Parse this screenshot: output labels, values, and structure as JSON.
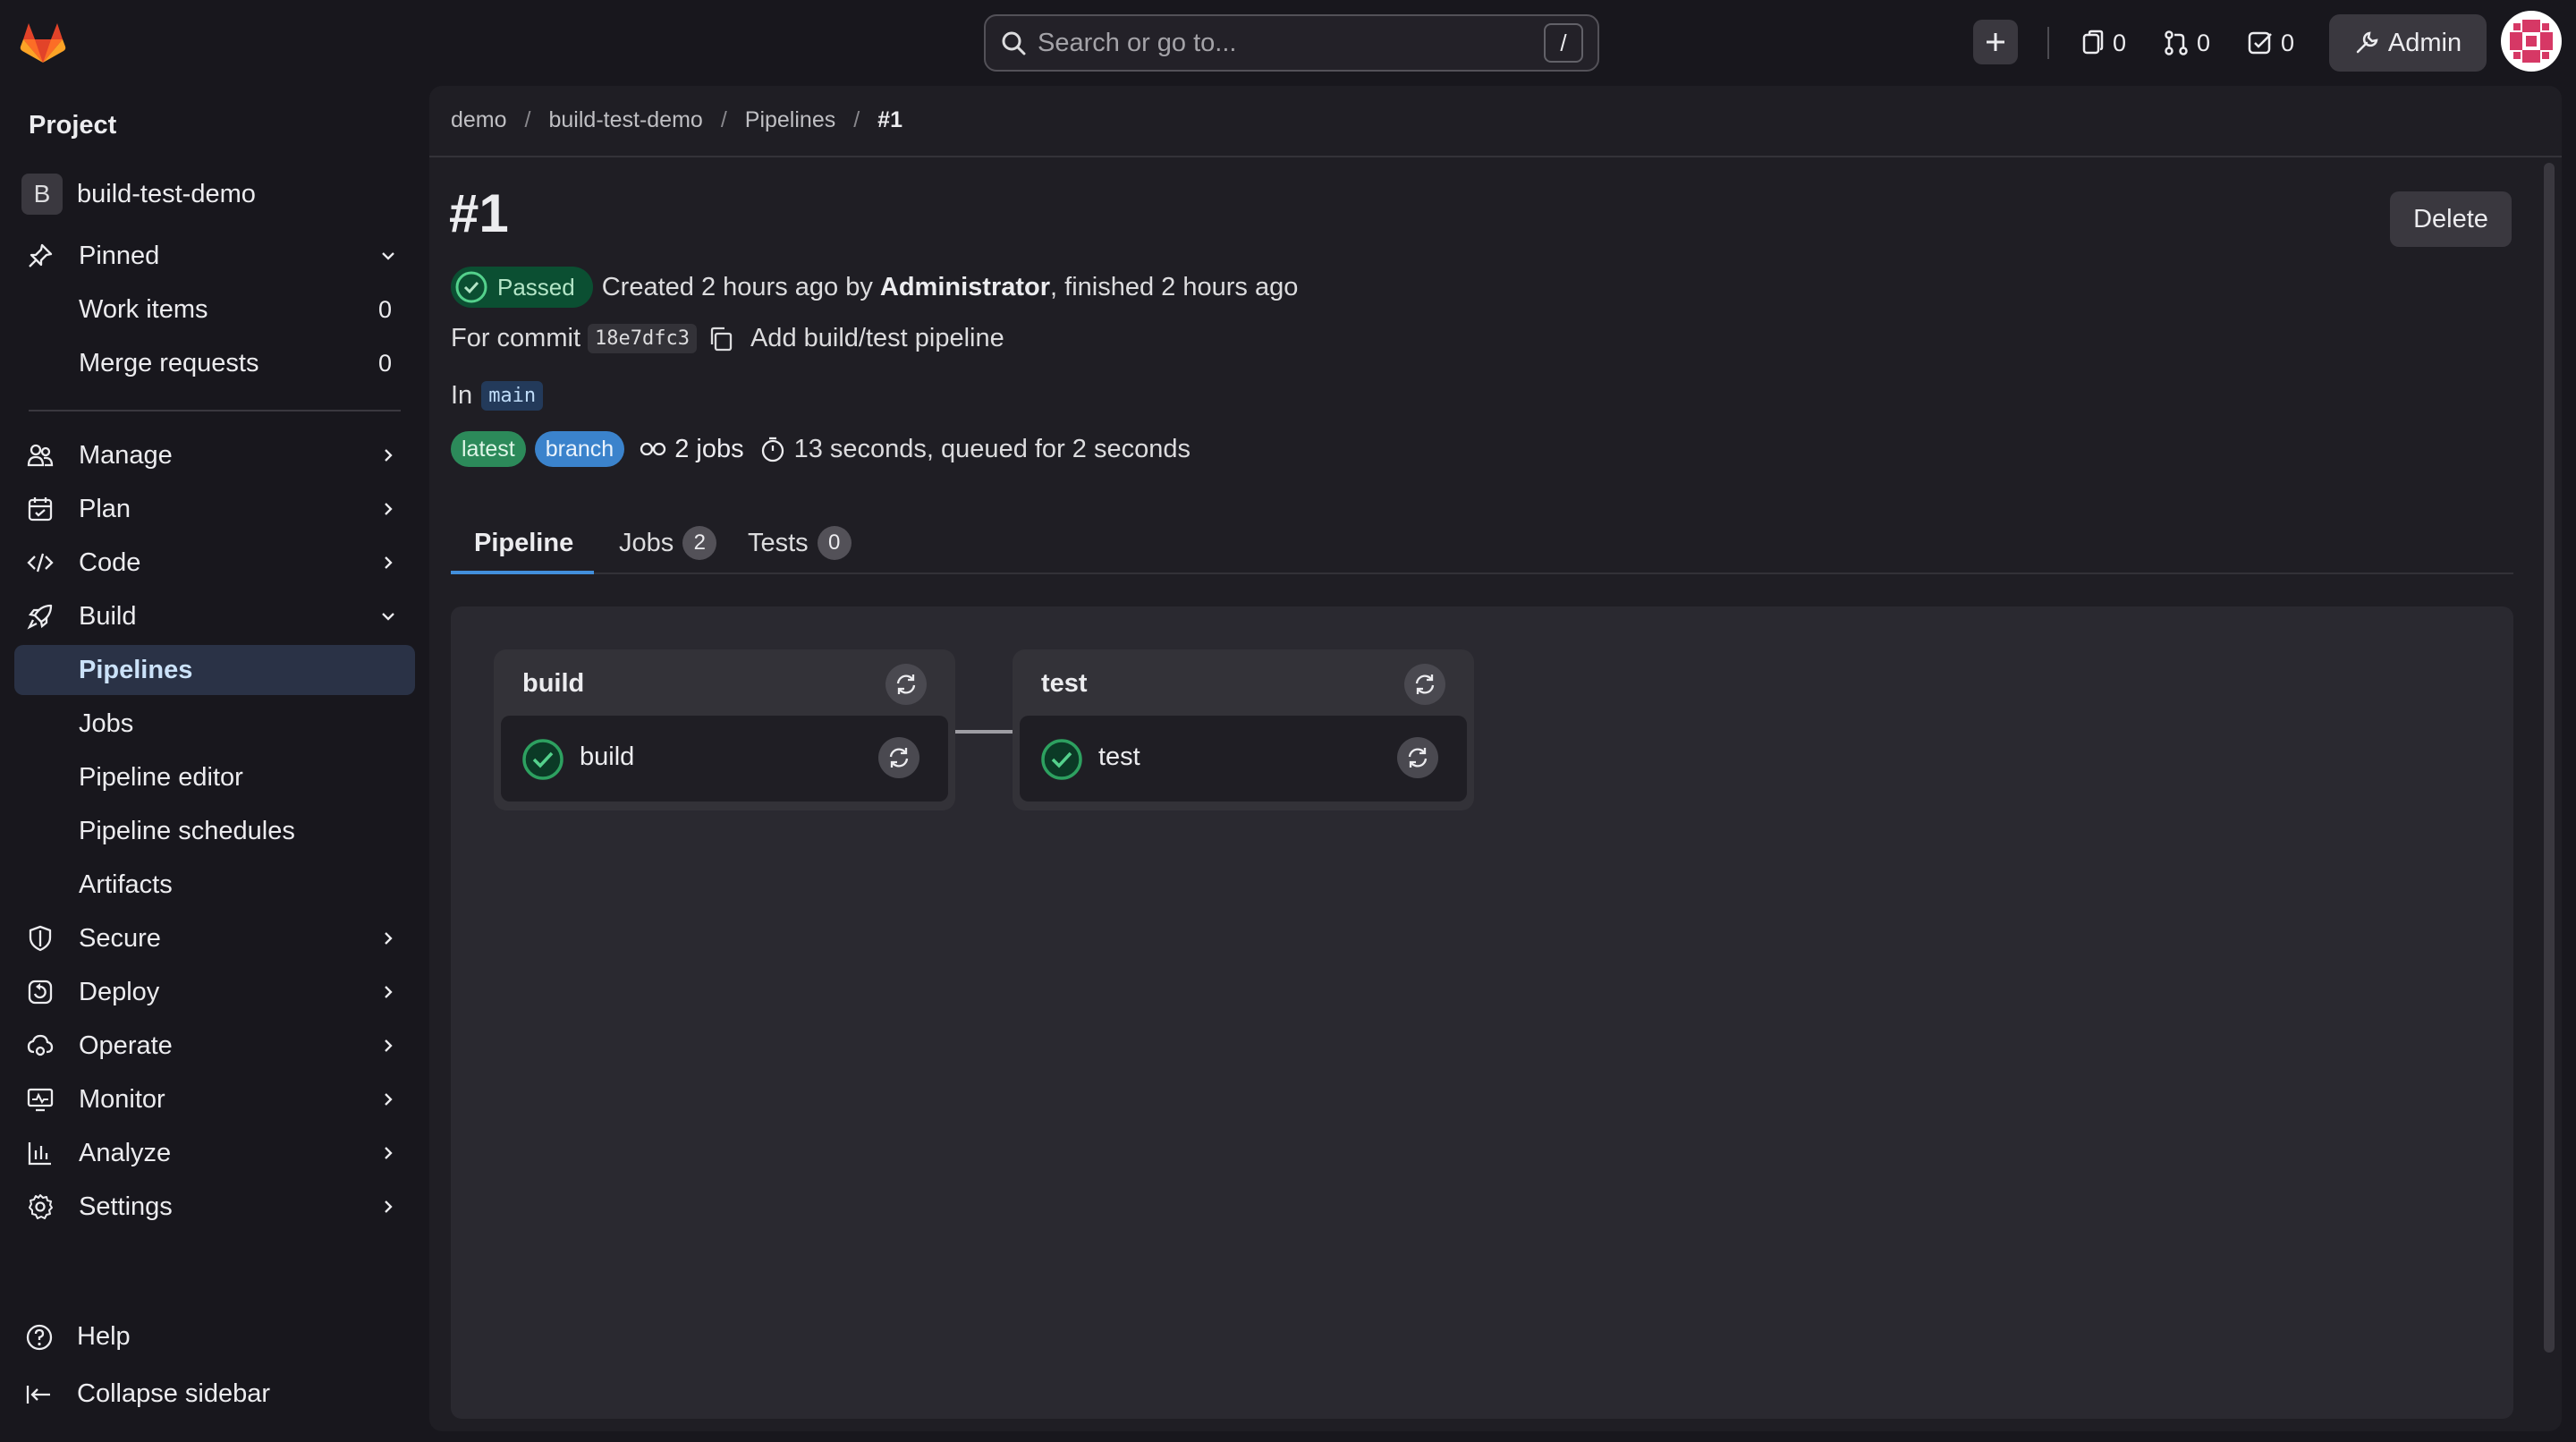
{
  "header": {
    "search_placeholder": "Search or go to...",
    "search_shortcut": "/",
    "issues_count": "0",
    "merge_requests_count": "0",
    "todos_count": "0",
    "admin_label": "Admin"
  },
  "sidebar": {
    "section_title": "Project",
    "project_initial": "B",
    "project_name": "build-test-demo",
    "pinned_label": "Pinned",
    "pinned_items": [
      {
        "label": "Work items",
        "count": "0"
      },
      {
        "label": "Merge requests",
        "count": "0"
      }
    ],
    "nav": [
      {
        "label": "Manage"
      },
      {
        "label": "Plan"
      },
      {
        "label": "Code"
      },
      {
        "label": "Build"
      },
      {
        "label": "Pipelines"
      },
      {
        "label": "Jobs"
      },
      {
        "label": "Pipeline editor"
      },
      {
        "label": "Pipeline schedules"
      },
      {
        "label": "Artifacts"
      },
      {
        "label": "Secure"
      },
      {
        "label": "Deploy"
      },
      {
        "label": "Operate"
      },
      {
        "label": "Monitor"
      },
      {
        "label": "Analyze"
      },
      {
        "label": "Settings"
      }
    ],
    "help_label": "Help",
    "collapse_label": "Collapse sidebar"
  },
  "breadcrumb": [
    "demo",
    "build-test-demo",
    "Pipelines",
    "#1"
  ],
  "pipeline": {
    "title": "#1",
    "delete_label": "Delete",
    "status": "Passed",
    "created_prefix": "Created 2 hours ago by",
    "author": "Administrator",
    "finished_text": ", finished 2 hours ago",
    "commit_prefix": "For commit",
    "commit_sha": "18e7dfc3",
    "commit_message": "Add build/test pipeline",
    "branch_prefix": "In",
    "branch": "main",
    "badge_latest": "latest",
    "badge_branch": "branch",
    "jobs_text": "2 jobs",
    "duration_text": "13 seconds, queued for 2 seconds"
  },
  "tabs": [
    {
      "label": "Pipeline"
    },
    {
      "label": "Jobs",
      "count": "2"
    },
    {
      "label": "Tests",
      "count": "0"
    }
  ],
  "stages": [
    {
      "name": "build",
      "job": "build"
    },
    {
      "name": "test",
      "job": "test"
    }
  ],
  "colors": {
    "accent": "#428fdc",
    "success": "#2da160",
    "background": "#18171d"
  }
}
